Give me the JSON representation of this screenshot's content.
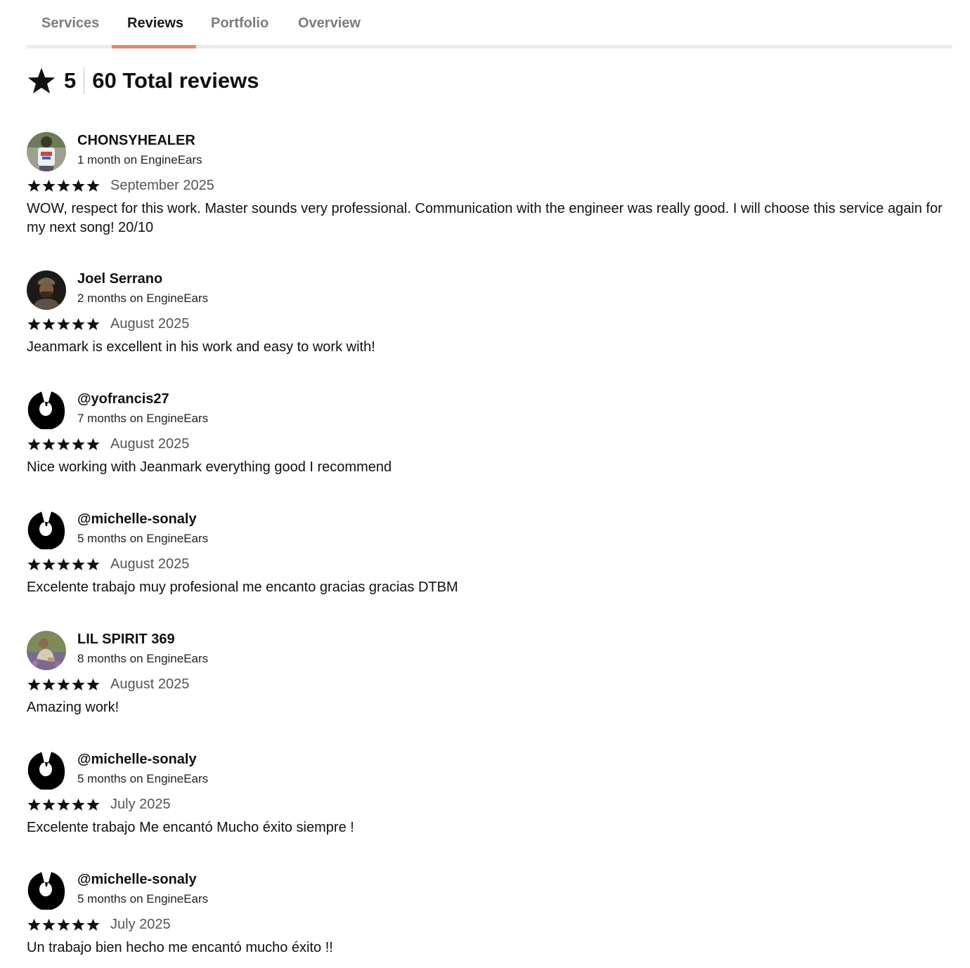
{
  "tabs": [
    {
      "label": "Services",
      "active": false
    },
    {
      "label": "Reviews",
      "active": true
    },
    {
      "label": "Portfolio",
      "active": false
    },
    {
      "label": "Overview",
      "active": false
    }
  ],
  "accent_color": "#e88a6f",
  "summary": {
    "icon": "star-icon",
    "rating": "5",
    "total_label": "60 Total reviews"
  },
  "reviews": [
    {
      "name": "CHONSYHEALER",
      "tenure": "1 month on EngineEars",
      "stars": 5,
      "date": "September 2025",
      "text": "WOW, respect for this work. Master sounds very professional. Communication with the engineer was really good. I will choose this service again for my next song! 20/10",
      "avatar": "photo-avatar"
    },
    {
      "name": "Joel Serrano",
      "tenure": "2 months on EngineEars",
      "stars": 5,
      "date": "August 2025",
      "text": "Jeanmark is excellent in his work and easy to work with!",
      "avatar": "photo-avatar"
    },
    {
      "name": "@yofrancis27",
      "tenure": "7 months on EngineEars",
      "stars": 5,
      "date": "August 2025",
      "text": "Nice working with Jeanmark  everything good  I recommend",
      "avatar": "default-avatar-icon"
    },
    {
      "name": "@michelle-sonaly",
      "tenure": "5 months on EngineEars",
      "stars": 5,
      "date": "August 2025",
      "text": "Excelente trabajo muy profesional me encanto gracias gracias DTBM",
      "avatar": "default-avatar-icon"
    },
    {
      "name": "LIL SPIRIT 369",
      "tenure": "8 months on EngineEars",
      "stars": 5,
      "date": "August 2025",
      "text": "Amazing work!",
      "avatar": "photo-avatar"
    },
    {
      "name": "@michelle-sonaly",
      "tenure": "5 months on EngineEars",
      "stars": 5,
      "date": "July 2025",
      "text": "Excelente trabajo Me encantó Mucho éxito siempre !",
      "avatar": "default-avatar-icon"
    },
    {
      "name": "@michelle-sonaly",
      "tenure": "5 months on EngineEars",
      "stars": 5,
      "date": "July 2025",
      "text": "Un trabajo bien hecho me encantó mucho éxito !!",
      "avatar": "default-avatar-icon"
    }
  ]
}
